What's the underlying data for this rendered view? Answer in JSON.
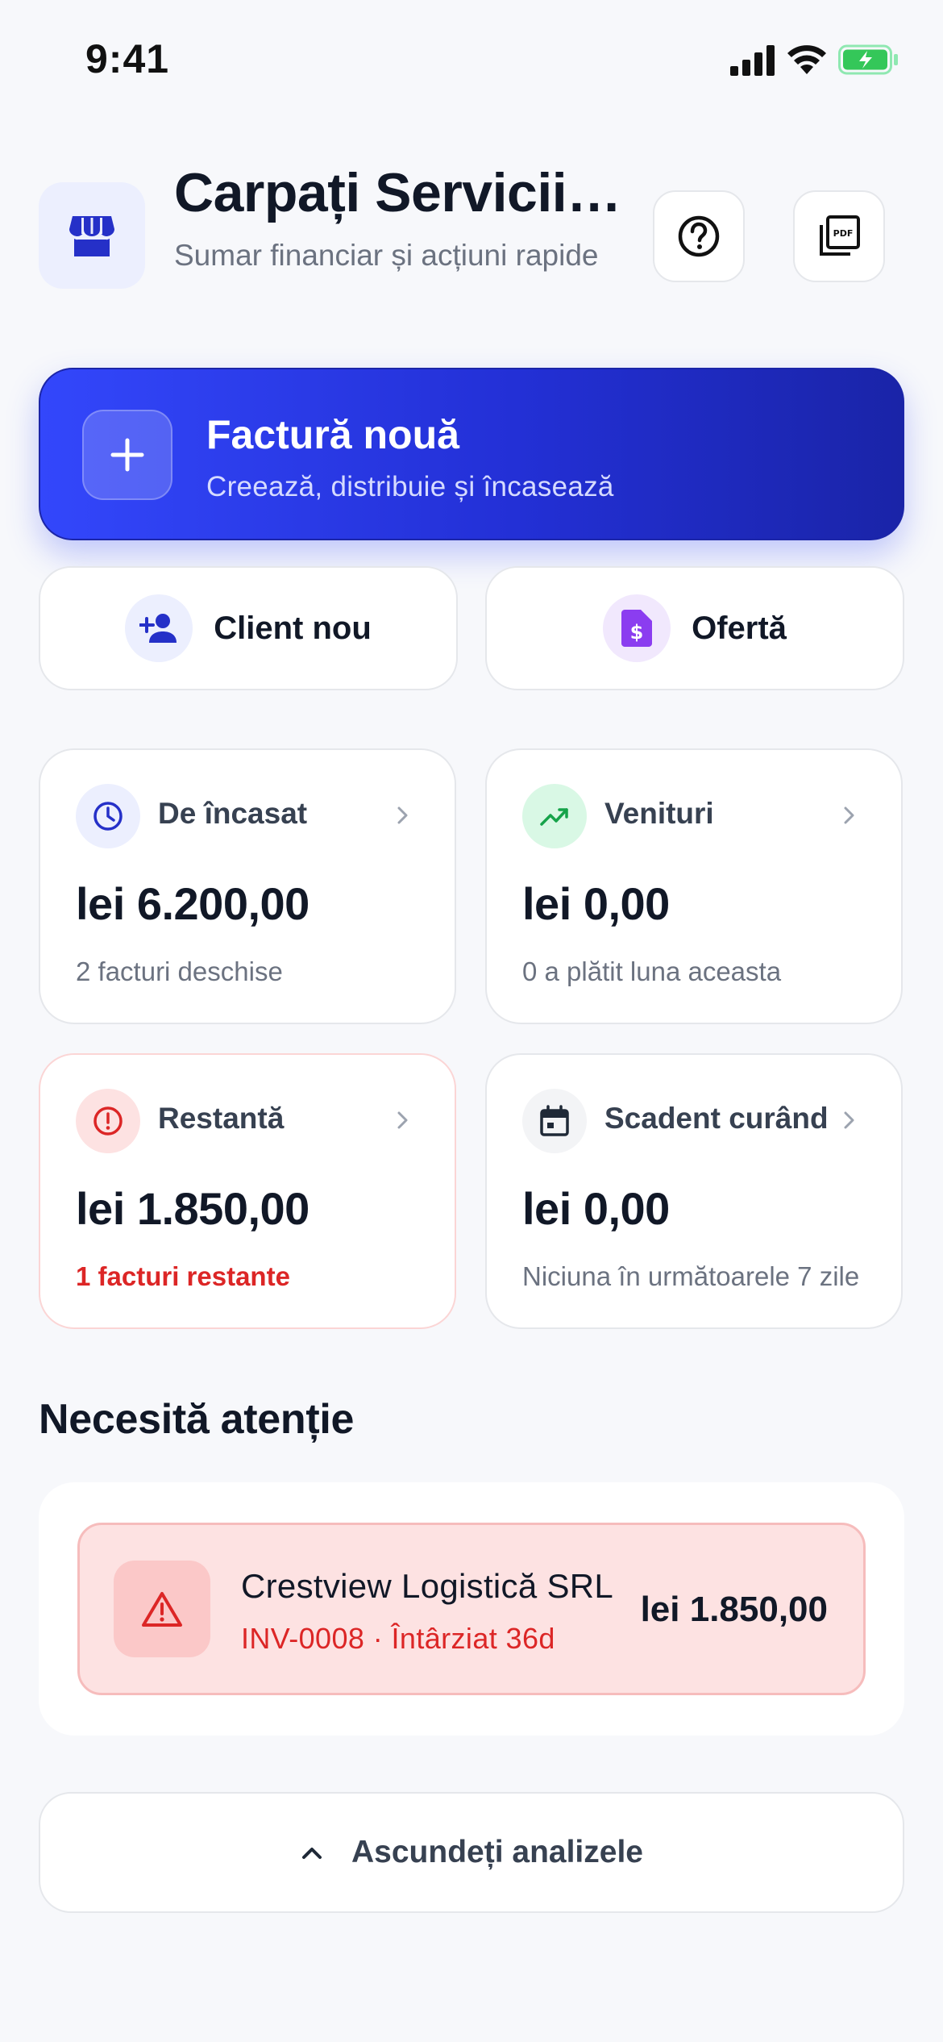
{
  "status_bar": {
    "time": "9:41"
  },
  "header": {
    "title": "Carpați Servicii SRL",
    "subtitle": "Sumar financiar și acțiuni rapide",
    "pdf_icon_text": "PDF"
  },
  "primary_action": {
    "title": "Factură nouă",
    "subtitle": "Creează, distribuie și încasează"
  },
  "secondary_actions": [
    {
      "label": "Client nou",
      "icon": "person-add-icon"
    },
    {
      "label": "Ofertă",
      "icon": "invoice-dollar-icon"
    }
  ],
  "stats": [
    {
      "label": "De încasat",
      "value": "lei 6.200,00",
      "note": "2 facturi deschise",
      "icon": "clock-icon"
    },
    {
      "label": "Venituri",
      "value": "lei 0,00",
      "note": "0 a plătit luna aceasta",
      "icon": "trending-up-icon"
    },
    {
      "label": "Restantă",
      "value": "lei 1.850,00",
      "note": "1 facturi restante",
      "icon": "alert-circle-icon"
    },
    {
      "label": "Scadent curând",
      "value": "lei 0,00",
      "note": "Niciuna în următoarele 7 zile",
      "icon": "calendar-icon"
    }
  ],
  "attention": {
    "title": "Necesită atenție",
    "items": [
      {
        "client": "Crestview Logistică SRL",
        "meta": "INV-0008 · Întârziat 36d",
        "amount": "lei 1.850,00"
      }
    ]
  },
  "toggle": {
    "label": "Ascundeți analizele"
  },
  "colors": {
    "accent": "#3347fb",
    "accent_dark": "#1a24a8",
    "danger": "#dc2626",
    "success": "#16a34a",
    "background": "#f7f8fb"
  }
}
